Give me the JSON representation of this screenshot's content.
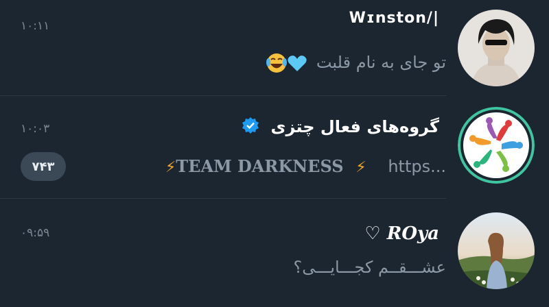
{
  "chats": [
    {
      "name": "Wɪnston/|",
      "time": "۱۰:۱۱",
      "message": "تو جای به نام قلبت",
      "emojis": "💙😂",
      "avatar": "person-dark-hair-avatar"
    },
    {
      "name": "گروه‌های فعال چتزی",
      "verified": true,
      "time": "۱۰:۰۳",
      "message_rtl": "https...",
      "message_team": "TEAM DARKNESS",
      "lightning": "⚡",
      "unread": "۷۴۳",
      "avatar": "colorful-group-logo"
    },
    {
      "name": "♡ 𝑹𝑶𝒚𝒂",
      "time": "۰۹:۵۹",
      "message": "عشـــقــم کجـــایـــی؟",
      "avatar": "girl-landscape-photo-avatar"
    }
  ],
  "colors": {
    "background": "#1c2630",
    "divider": "#2c3a47",
    "muted_text": "#8b98a5",
    "verified_blue": "#1d9bf0",
    "badge_bg": "#3b4957"
  }
}
